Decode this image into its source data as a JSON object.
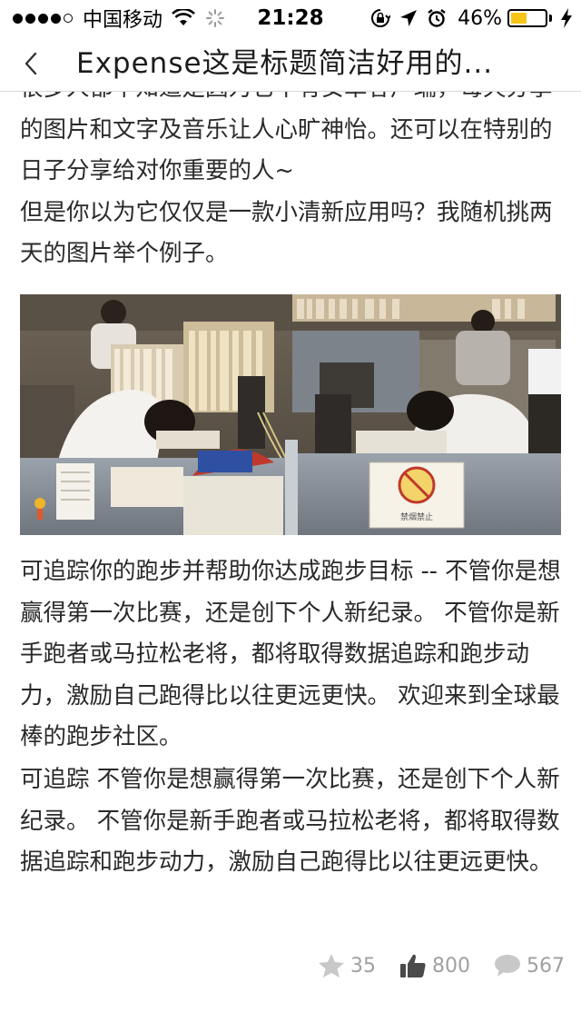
{
  "status_bar": {
    "carrier": "中国移动",
    "time": "21:28",
    "battery_percent": "46%",
    "battery_level": 0.46,
    "battery_color": "#f5c518",
    "icons": [
      "signal-dots",
      "wifi-icon",
      "spinner-icon",
      "orientation-lock-icon",
      "location-icon",
      "alarm-icon",
      "battery-icon",
      "charging-bolt-icon"
    ]
  },
  "nav": {
    "back_icon": "chevron-left-icon",
    "title": "Expense这是标题简洁好用的..."
  },
  "article": {
    "para1": "很多人都不知道是因为它不有安卓客户端，每天分享的图片和文字及音乐让人心旷神怡。还可以在特别的日子分享给对你重要的人~\n但是你以为它仅仅是一款小清新应用吗？我随机挑两天的图片举个例子。",
    "photo_sign_text": "禁烟禁止",
    "para2": "可追踪你的跑步并帮助你达成跑步目标 -- 不管你是想赢得第一次比赛，还是创下个人新纪录。 不管你是新手跑者或马拉松老将，都将取得数据追踪和跑步动力，激励自己跑得比以往更远更快。 欢迎来到全球最棒的跑步社区。",
    "para3": "可追踪 不管你是想赢得第一次比赛，还是创下个人新纪录。 不管你是新手跑者或马拉松老将，都将取得数据追踪和跑步动力，激励自己跑得比以往更远更快。"
  },
  "stats": {
    "favorites": "35",
    "likes": "800",
    "comments": "567",
    "icon_color": "#c8c8c8",
    "like_icon_color": "#4a4a4a"
  }
}
